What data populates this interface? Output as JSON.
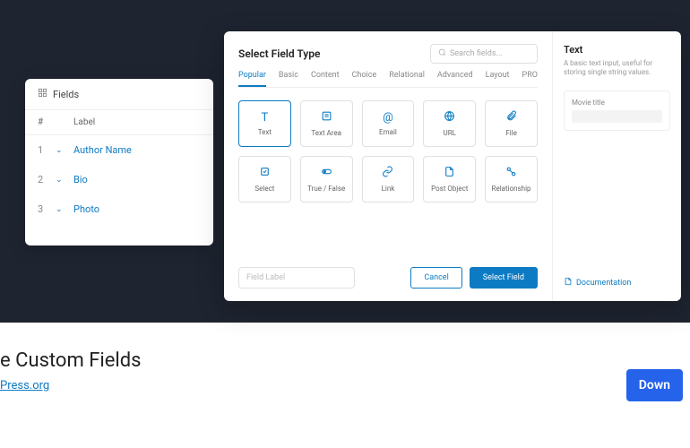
{
  "fields_panel": {
    "title": "Fields",
    "columns": {
      "num": "#",
      "label": "Label"
    },
    "rows": [
      {
        "num": "1",
        "label": "Author Name"
      },
      {
        "num": "2",
        "label": "Bio"
      },
      {
        "num": "3",
        "label": "Photo"
      }
    ]
  },
  "modal": {
    "title": "Select Field Type",
    "search_placeholder": "Search fields...",
    "tabs": [
      "Popular",
      "Basic",
      "Content",
      "Choice",
      "Relational",
      "Advanced",
      "Layout",
      "PRO"
    ],
    "field_types_row1": [
      {
        "label": "Text"
      },
      {
        "label": "Text Area"
      },
      {
        "label": "Email"
      },
      {
        "label": "URL"
      },
      {
        "label": "File"
      }
    ],
    "field_types_row2": [
      {
        "label": "Select"
      },
      {
        "label": "True / False"
      },
      {
        "label": "Link"
      },
      {
        "label": "Post Object"
      },
      {
        "label": "Relationship"
      }
    ],
    "field_label_placeholder": "Field Label",
    "cancel": "Cancel",
    "select": "Select Field"
  },
  "side": {
    "title": "Text",
    "desc": "A basic text input, useful for storing single string values.",
    "preview_label": "Movie title",
    "doc": "Documentation"
  },
  "bottom": {
    "title": "e Custom Fields",
    "link": "Press.org",
    "download": "Down"
  }
}
